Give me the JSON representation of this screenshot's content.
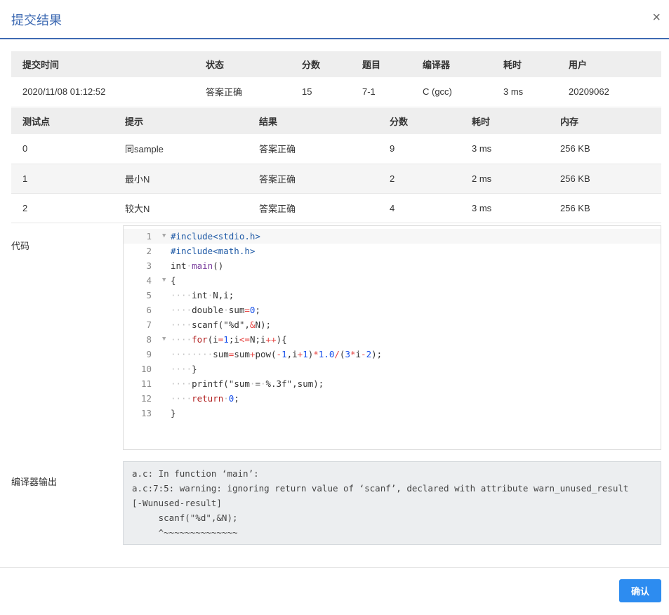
{
  "dialog": {
    "title": "提交结果",
    "close_glyph": "×"
  },
  "summary": {
    "headers": [
      "提交时间",
      "状态",
      "分数",
      "题目",
      "编译器",
      "耗时",
      "用户"
    ],
    "row": {
      "time": "2020/11/08 01:12:52",
      "status": "答案正确",
      "score": "15",
      "problem": "7-1",
      "compiler": "C (gcc)",
      "duration": "3 ms",
      "user": "20209062"
    }
  },
  "cases": {
    "headers": [
      "测试点",
      "提示",
      "结果",
      "分数",
      "耗时",
      "内存"
    ],
    "rows": [
      {
        "id": "0",
        "hint": "同sample",
        "result": "答案正确",
        "score": "9",
        "time": "3 ms",
        "memory": "256 KB"
      },
      {
        "id": "1",
        "hint": "最小N",
        "result": "答案正确",
        "score": "2",
        "time": "2 ms",
        "memory": "256 KB"
      },
      {
        "id": "2",
        "hint": "较大N",
        "result": "答案正确",
        "score": "4",
        "time": "3 ms",
        "memory": "256 KB"
      }
    ]
  },
  "code": {
    "label": "代码",
    "line_numbers": [
      "1",
      "2",
      "3",
      "4",
      "5",
      "6",
      "7",
      "8",
      "9",
      "10",
      "11",
      "12",
      "13"
    ],
    "lines": [
      "#include<stdio.h>",
      "#include<math.h>",
      "int main()",
      "{",
      "    int N,i;",
      "    double sum=0;",
      "    scanf(\"%d\",&N);",
      "    for(i=1;i<=N;i++){",
      "        sum=sum+pow(-1,i+1)*1.0/(3*i-2);",
      "    }",
      "    printf(\"sum = %.3f\",sum);",
      "    return 0;",
      "}"
    ]
  },
  "compiler_output": {
    "label": "编译器输出",
    "lines": [
      "a.c: In function ‘main’:",
      "a.c:7:5: warning: ignoring return value of ‘scanf’, declared with attribute warn_unused_result",
      "[-Wunused-result]",
      "     scanf(\"%d\",&N);",
      "     ^~~~~~~~~~~~~~~"
    ]
  },
  "footer": {
    "confirm_label": "确认"
  },
  "colors": {
    "accent": "#3f6bb3",
    "success_text": "#e64340",
    "button": "#2d8cf0"
  }
}
